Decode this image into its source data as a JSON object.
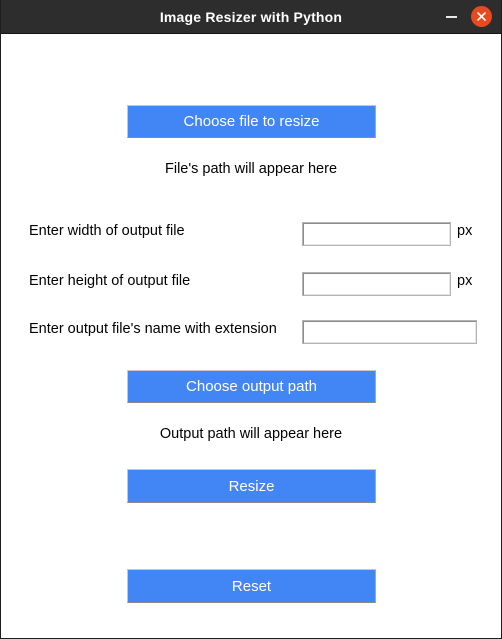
{
  "window": {
    "title": "Image Resizer with Python",
    "controls": {
      "minimize_icon": "minimize-icon",
      "close_icon": "close-icon"
    },
    "colors": {
      "titlebar_bg": "#2d2d2d",
      "titlebar_text": "#ffffff",
      "close_button_bg": "#e8491e",
      "button_bg": "#4285f4",
      "button_text": "#ffffff",
      "body_bg": "#ffffff",
      "text": "#000000"
    }
  },
  "main": {
    "choose_file_button": "Choose file to resize",
    "file_path_status": "File's path will appear here",
    "width_row": {
      "label": "Enter width of output file",
      "value": "",
      "placeholder": "",
      "unit": "px"
    },
    "height_row": {
      "label": "Enter height of output file",
      "value": "",
      "placeholder": "",
      "unit": "px"
    },
    "filename_row": {
      "label": "Enter output file's name with extension",
      "value": "",
      "placeholder": ""
    },
    "choose_output_path_button": "Choose output path",
    "output_path_status": "Output path will appear here",
    "resize_button": "Resize",
    "reset_button": "Reset"
  }
}
